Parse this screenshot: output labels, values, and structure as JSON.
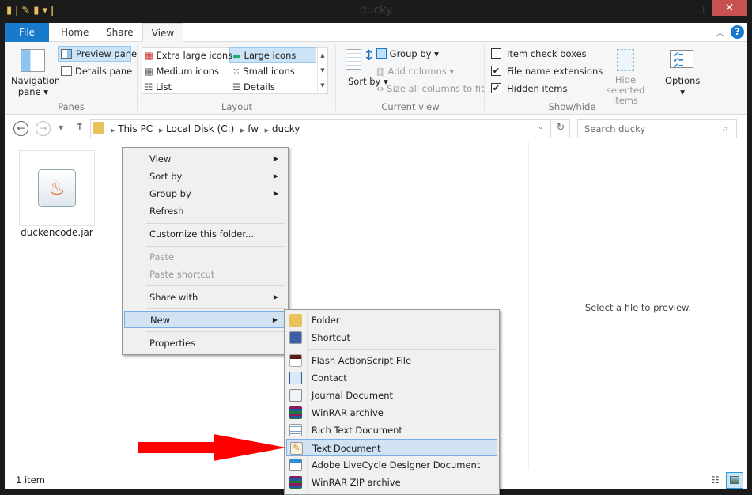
{
  "window": {
    "title": "ducky",
    "close": "✕",
    "minimize": "–",
    "maximize": "□"
  },
  "tabs": {
    "file": "File",
    "home": "Home",
    "share": "Share",
    "view": "View"
  },
  "ribbon": {
    "panes": {
      "label": "Panes",
      "navigation_pane": "Navigation pane",
      "preview_pane": "Preview pane",
      "details_pane": "Details pane"
    },
    "layout": {
      "label": "Layout",
      "items": [
        "Extra large icons",
        "Large icons",
        "Medium icons",
        "Small icons",
        "List",
        "Details"
      ],
      "selected": "Large icons"
    },
    "current_view": {
      "label": "Current view",
      "sort_by": "Sort by",
      "group_by": "Group by",
      "add_columns": "Add columns",
      "size_columns": "Size all columns to fit"
    },
    "show_hide": {
      "label": "Show/hide",
      "item_check_boxes": "Item check boxes",
      "item_check_boxes_checked": false,
      "file_name_extensions": "File name extensions",
      "file_name_extensions_checked": true,
      "hidden_items": "Hidden items",
      "hidden_items_checked": true,
      "hide_selected": "Hide selected items"
    },
    "options": "Options"
  },
  "address": {
    "crumbs": [
      "This PC",
      "Local Disk (C:)",
      "fw",
      "ducky"
    ]
  },
  "search": {
    "placeholder": "Search ducky"
  },
  "files": [
    {
      "name": "duckencode.jar",
      "icon": "java-icon"
    }
  ],
  "preview": {
    "message": "Select a file to preview."
  },
  "context_menu": {
    "items": [
      "View",
      "Sort by",
      "Group by",
      "Refresh",
      "Customize this folder...",
      "Paste",
      "Paste shortcut",
      "Share with",
      "New",
      "Properties"
    ],
    "highlighted": "New"
  },
  "new_submenu": {
    "items": [
      "Folder",
      "Shortcut",
      "Flash ActionScript File",
      "Contact",
      "Journal Document",
      "WinRAR archive",
      "Rich Text Document",
      "Text Document",
      "Adobe LiveCycle Designer Document",
      "WinRAR ZIP archive"
    ],
    "highlighted": "Text Document"
  },
  "status": {
    "count": "1 item"
  },
  "colors": {
    "accent": "#1979ca",
    "close": "#c75050",
    "highlight": "#d1e2f2",
    "arrow": "#ff0000"
  }
}
